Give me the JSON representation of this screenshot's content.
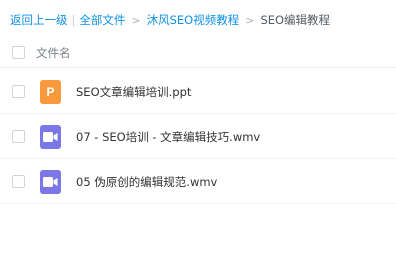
{
  "breadcrumb": {
    "back": "返回上一级",
    "separator_bar": "|",
    "items": [
      "全部文件",
      "沐风SEO视频教程"
    ],
    "separator_gt": ">",
    "current": "SEO编辑教程"
  },
  "list": {
    "header_label": "文件名",
    "files": [
      {
        "name": "SEO文章编辑培训.ppt",
        "type": "ppt",
        "icon": "ppt-file-icon",
        "icon_letter": "P",
        "color": "#f89a3c"
      },
      {
        "name": "07 - SEO培训 - 文章编辑技巧.wmv",
        "type": "video",
        "icon": "video-file-icon",
        "color": "#7b77e6"
      },
      {
        "name": "05 伪原创的编辑规范.wmv",
        "type": "video",
        "icon": "video-file-icon",
        "color": "#7b77e6"
      }
    ]
  },
  "colors": {
    "link": "#0d91e6",
    "text": "#333333",
    "muted": "#7a7f87"
  }
}
